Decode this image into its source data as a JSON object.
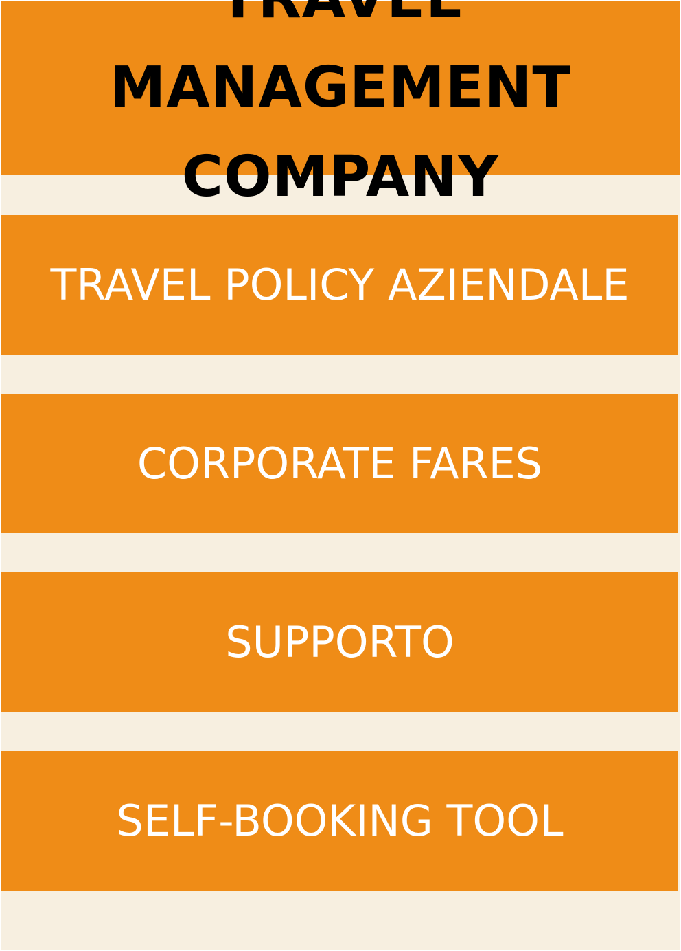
{
  "header": {
    "title": "TRAVEL MANAGEMENT COMPANY"
  },
  "items": [
    {
      "label": "TRAVEL POLICY AZIENDALE"
    },
    {
      "label": "CORPORATE FARES"
    },
    {
      "label": "SUPPORTO"
    },
    {
      "label": "SELF-BOOKING TOOL"
    }
  ],
  "colors": {
    "accent": "#ef8c17",
    "background": "#f7efe0",
    "title_text": "#000000",
    "item_text": "#ffffff"
  }
}
